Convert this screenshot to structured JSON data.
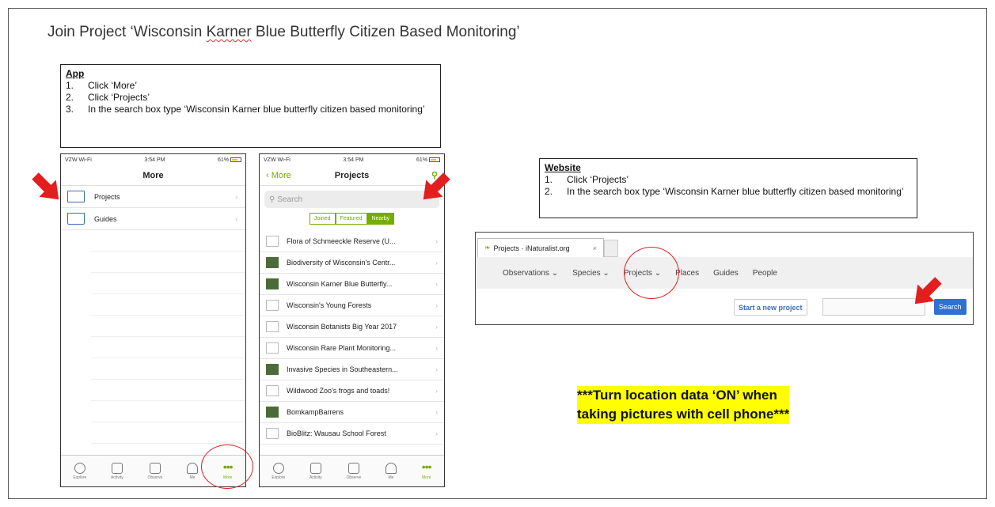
{
  "title": {
    "prefix": "Join Project ‘Wisconsin ",
    "karner": "Karner",
    "suffix": " Blue Butterfly Citizen Based Monitoring’"
  },
  "app_box": {
    "heading": "App",
    "steps": [
      {
        "num": "1.",
        "text": "Click ‘More’"
      },
      {
        "num": "2.",
        "text": "Click ‘Projects’"
      },
      {
        "num": "3.",
        "text": "In the search box type ‘Wisconsin Karner blue butterfly citizen based monitoring’"
      }
    ]
  },
  "website_box": {
    "heading": "Website",
    "steps": [
      {
        "num": "1.",
        "text": "Click ‘Projects’"
      },
      {
        "num": "2.",
        "text": "In the search box type ‘Wisconsin Karner blue butterfly citizen based monitoring’"
      }
    ]
  },
  "phone_status": {
    "carrier": "VZW Wi-Fi",
    "time": "3:54 PM",
    "battery": "61%"
  },
  "phone1": {
    "nav_title": "More",
    "items": [
      {
        "label": "Projects",
        "icon": "folder-icon"
      },
      {
        "label": "Guides",
        "icon": "book-icon"
      }
    ]
  },
  "phone2": {
    "back": "More",
    "nav_title": "Projects",
    "search_placeholder": "Search",
    "segments": [
      "Joined",
      "Featured",
      "Nearby"
    ],
    "active_segment": "Nearby",
    "projects": [
      {
        "name": "Flora of Schmeeckle Reserve (U...",
        "img": false
      },
      {
        "name": "Biodiversity of Wisconsin's Centr...",
        "img": true
      },
      {
        "name": "Wisconsin Karner Blue Butterfly...",
        "img": true
      },
      {
        "name": "Wisconsin's Young Forests",
        "img": false
      },
      {
        "name": "Wisconsin Botanists Big Year 2017",
        "img": false
      },
      {
        "name": "Wisconsin Rare Plant Monitoring...",
        "img": false
      },
      {
        "name": "Invasive Species in Southeastern...",
        "img": true
      },
      {
        "name": "Wildwood Zoo's frogs and toads!",
        "img": false
      },
      {
        "name": "BomkampBarrens",
        "img": true
      },
      {
        "name": "BioBlitz: Wausau School Forest",
        "img": false
      }
    ]
  },
  "tabbar": [
    {
      "label": "Explore",
      "icon": "globe-icon"
    },
    {
      "label": "Activity",
      "icon": "list-icon"
    },
    {
      "label": "Observe",
      "icon": "camera-icon"
    },
    {
      "label": "Me",
      "icon": "person-icon"
    },
    {
      "label": "More",
      "icon": "more-dots-icon",
      "glyph": "•••"
    }
  ],
  "website": {
    "tab_title": "Projects · iNaturalist.org",
    "nav": [
      "Observations ⌄",
      "Species ⌄",
      "Projects ⌄",
      "Places",
      "Guides",
      "People"
    ],
    "new_project": "Start a new project",
    "search_btn": "Search"
  },
  "note": {
    "line1": "***Turn location data ‘ON’ when",
    "line2": "taking pictures with cell phone***"
  },
  "colors": {
    "accent": "#74ac00",
    "arrow": "#e31e1e",
    "highlight": "#ffff00",
    "web_button": "#2f70d1"
  }
}
